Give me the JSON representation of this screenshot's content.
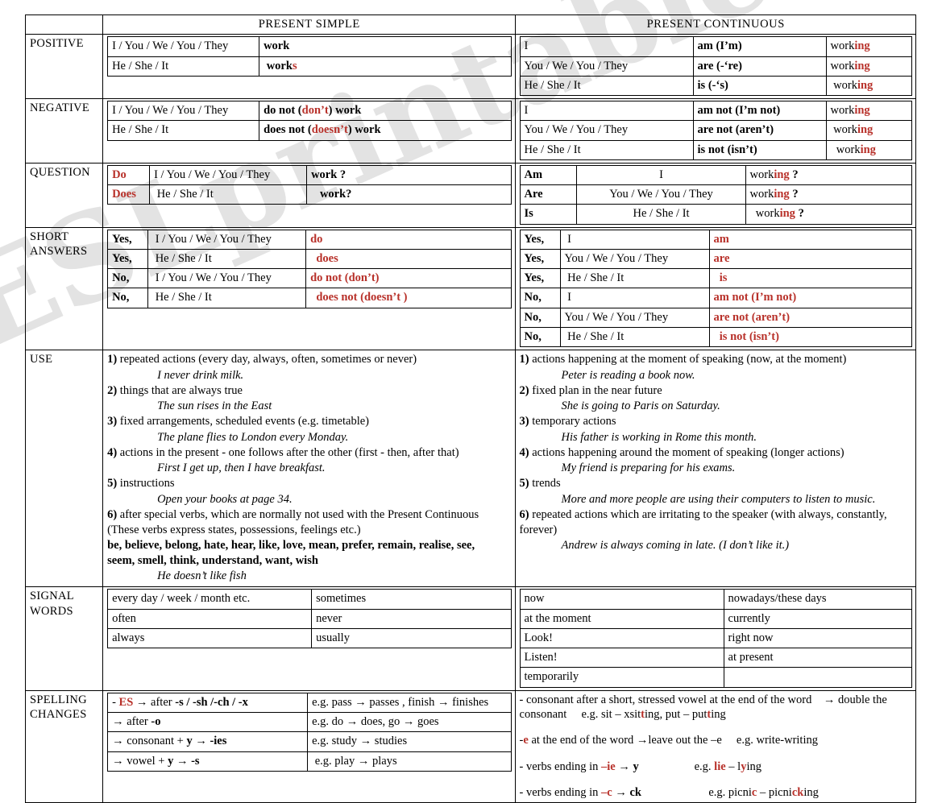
{
  "watermark": "ESLprintables.com",
  "accent_red": "#b8312a",
  "table": {
    "header": {
      "label": "",
      "present_simple": "PRESENT SIMPLE",
      "present_continuous": "PRESENT CONTINUOUS"
    },
    "rows": {
      "positive": {
        "label": "POSITIVE",
        "present_simple": [
          {
            "subject": "I / You / We / You / They",
            "form_plain": "work",
            "form_red": ""
          },
          {
            "subject": "He / She / It",
            "form_plain": "work",
            "form_red": "s"
          }
        ],
        "present_continuous": [
          {
            "subject": "I",
            "aux": "am (I’m)",
            "verb_plain": "work",
            "verb_red": "ing"
          },
          {
            "subject": "You / We / You / They",
            "aux": "are (-‘re)",
            "verb_plain": "work",
            "verb_red": "ing"
          },
          {
            "subject": "He / She / It",
            "aux": "is    (-‘s)",
            "verb_plain": "work",
            "verb_red": "ing"
          }
        ]
      },
      "negative": {
        "label": "NEGATIVE",
        "present_simple": [
          {
            "subject": "I / You / We / You / They",
            "pre": "do not (",
            "red": "don’t",
            "post": ") work"
          },
          {
            "subject": "He / She / It",
            "pre": "does not (",
            "red": "doesn’t",
            "post": ") work"
          }
        ],
        "present_continuous": [
          {
            "subject": "I",
            "aux": "am not (I’m not)",
            "verb_plain": "work",
            "verb_red": "ing"
          },
          {
            "subject": "You / We / You / They",
            "aux": "are not (aren’t)",
            "verb_plain": "work",
            "verb_red": "ing"
          },
          {
            "subject": "He / She / It",
            "aux": "is not (isn’t)",
            "verb_plain": "work",
            "verb_red": "ing"
          }
        ]
      },
      "question": {
        "label": "QUESTION",
        "present_simple": [
          {
            "aux_red": "Do",
            "subject": "I / You / We / You / They",
            "verb": "work ?"
          },
          {
            "aux_red": "Does",
            "subject": "He / She / It",
            "verb": "work?"
          }
        ],
        "present_continuous": [
          {
            "aux": "Am",
            "subject": "I",
            "verb_plain": "work",
            "verb_red": "ing",
            "tail": " ?"
          },
          {
            "aux": "Are",
            "subject": "You / We / You / They",
            "verb_plain": "work",
            "verb_red": "ing",
            "tail": " ?"
          },
          {
            "aux": "Is",
            "subject": "He / She / It",
            "verb_plain": "work",
            "verb_red": "ing",
            "tail": " ?"
          }
        ]
      },
      "short_answers": {
        "label_line1": "SHORT",
        "label_line2": "ANSWERS",
        "present_simple": [
          {
            "yesno": "Yes,",
            "subject": "I / You / We / You / They",
            "answer": "do"
          },
          {
            "yesno": "Yes,",
            "subject": "He / She / It",
            "answer": "does"
          },
          {
            "yesno": "No,",
            "subject": "I / You / We / You / They",
            "answer": "do not (don’t)"
          },
          {
            "yesno": "No,",
            "subject": "He / She / It",
            "answer": "does not (doesn’t )"
          }
        ],
        "present_continuous": [
          {
            "yesno": "Yes,",
            "subject": "I",
            "answer": "am"
          },
          {
            "yesno": "Yes,",
            "subject": "You / We / You / They",
            "answer": "are"
          },
          {
            "yesno": "Yes,",
            "subject": "He / She / It",
            "answer": "is"
          },
          {
            "yesno": "No,",
            "subject": "I",
            "answer": "am not (I’m not)"
          },
          {
            "yesno": "No,",
            "subject": "You / We / You / They",
            "answer": "are not (aren’t)"
          },
          {
            "yesno": "No,",
            "subject": "He / She / It",
            "answer": "is not (isn’t)"
          }
        ]
      },
      "use": {
        "label": "USE",
        "present_simple": [
          {
            "n": "1)",
            "text": " repeated actions  (every day, always, often, sometimes or never)",
            "example": "I never drink milk."
          },
          {
            "n": "2)",
            "text": " things that are always true",
            "example": "The sun rises in the East"
          },
          {
            "n": "3)",
            "text": " fixed arrangements, scheduled events (e.g. timetable)",
            "example": "The plane flies to London every Monday."
          },
          {
            "n": "4)",
            "text": " actions in the present - one follows after the other (first - then, after that)",
            "example": "First I get up, then I have breakfast."
          },
          {
            "n": "5)",
            "text": " instructions",
            "example": "Open your books at page 34."
          },
          {
            "n": "6)",
            "text": " after special verbs, which are normally not used with the Present Continuous",
            "text2": "(These verbs express states, possessions, feelings etc.)",
            "example": "He doesn’t like fish"
          }
        ],
        "present_simple_verbs_line1": "be, believe, belong, hate, hear, like, love, mean, prefer, remain, realise, see,",
        "present_simple_verbs_line2": "seem, smell, think, understand, want, wish",
        "present_continuous": [
          {
            "n": "1)",
            "text": " actions happening at the moment of speaking (now, at the moment)",
            "example": "Peter is reading a book now."
          },
          {
            "n": "2)",
            "text": " fixed plan in the near future",
            "example": "She is going to Paris on Saturday."
          },
          {
            "n": "3)",
            "text": " temporary actions",
            "example": "His father is working in Rome this month."
          },
          {
            "n": "4)",
            "text": " actions happening around the moment of speaking (longer actions)",
            "example": "My friend is preparing for his exams."
          },
          {
            "n": "5)",
            "text": " trends",
            "example": "More and more people are using their computers to listen to music."
          },
          {
            "n": "6)",
            "text": " repeated actions which are irritating to the speaker (with always, constantly,",
            "text2": "forever)",
            "example": "Andrew is always coming in late. (I don’t like it.)"
          }
        ]
      },
      "signal_words": {
        "label_line1": "SIGNAL",
        "label_line2": "WORDS",
        "present_simple": [
          {
            "a": "every day / week / month etc.",
            "b": "sometimes"
          },
          {
            "a": "often",
            "b": "never"
          },
          {
            "a": "always",
            "b": "usually"
          }
        ],
        "present_continuous": [
          {
            "a": "now",
            "b": "nowadays/these days"
          },
          {
            "a": "at the moment",
            "b": "currently"
          },
          {
            "a": "Look!",
            "b": "right now"
          },
          {
            "a": "Listen!",
            "b": "at present"
          },
          {
            "a": "temporarily",
            "b": ""
          }
        ]
      },
      "spelling_changes": {
        "label_line1": "SPELLING",
        "label_line2": "CHANGES",
        "present_simple": [
          {
            "dash": "- ",
            "red": "ES",
            "rule": " → after -s / -sh /-ch / -x",
            "example": "e.g. pass → passes , finish → finishes",
            "rule_bold_parts": "-s / -sh /-ch / -x"
          },
          {
            "dash": "",
            "red": "",
            "rule": "→ after -o",
            "example": "e.g. do → does, go → goes"
          },
          {
            "dash": "",
            "red": "",
            "rule": "→ consonant + y → -ies",
            "example": "e.g. study → studies"
          },
          {
            "dash": "",
            "red": "",
            "rule": "→ vowel + y → -s",
            "example": "e.g. play → plays"
          }
        ],
        "present_continuous": [
          {
            "rule": "- consonant after a short, stressed vowel at the end of the word",
            "arrow": "→ double the consonant",
            "example": "e.g. sit – sitting, put – putting"
          },
          {
            "rule": "-e at the end of the word →leave out the –e",
            "example": "e.g. write-writing"
          },
          {
            "rule": "- verbs ending in –ie → y",
            "example": "e.g. lie – lying"
          },
          {
            "rule": "- verbs ending in –c → ck",
            "example": "e.g. picnic – picnicking"
          }
        ]
      }
    }
  }
}
